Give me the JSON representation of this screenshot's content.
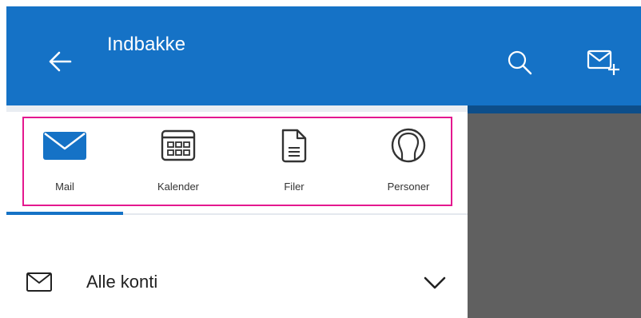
{
  "header": {
    "title": "Indbakke",
    "background_color": "#1572c6",
    "back_icon": "arrow-left-icon",
    "search_icon": "search-icon",
    "compose_icon": "new-mail-icon"
  },
  "nav": {
    "items": [
      {
        "label": "Mail",
        "icon": "mail-icon",
        "active": true
      },
      {
        "label": "Kalender",
        "icon": "calendar-icon",
        "active": false
      },
      {
        "label": "Filer",
        "icon": "file-icon",
        "active": false
      },
      {
        "label": "Personer",
        "icon": "people-icon",
        "active": false
      }
    ],
    "highlight_color": "#e4188f",
    "active_color": "#1572c6"
  },
  "accounts": {
    "label": "Alle konti",
    "icon": "envelope-outline-icon",
    "chevron": "chevron-down-icon"
  },
  "overlay_color": "#606060"
}
